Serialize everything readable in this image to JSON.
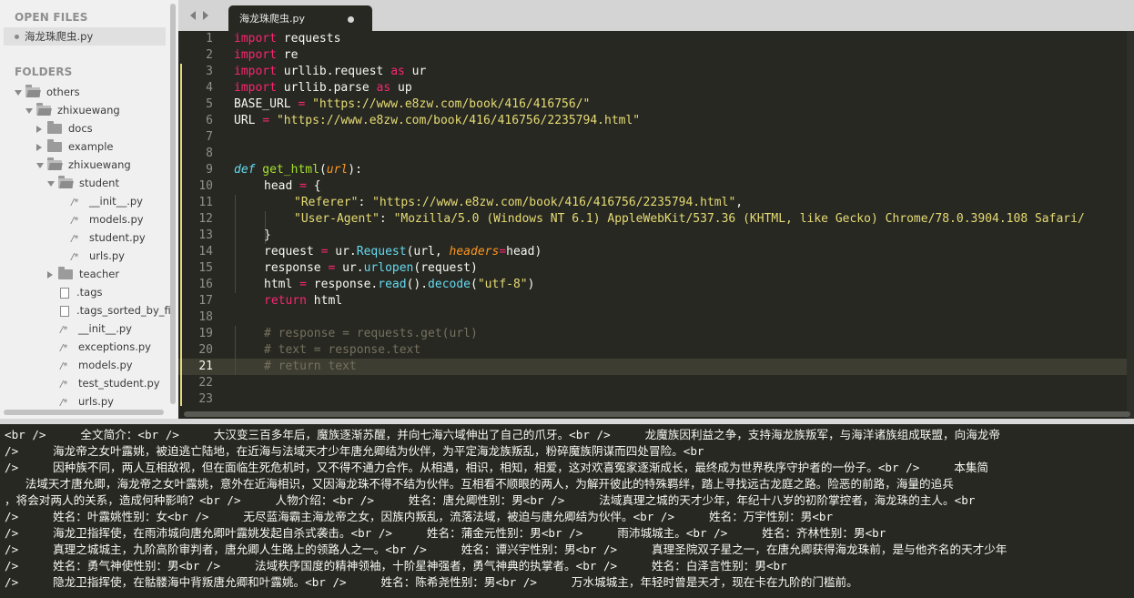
{
  "sidebar": {
    "open_files_heading": "OPEN FILES",
    "open_file": "海龙珠爬虫.py",
    "folders_heading": "FOLDERS",
    "tree": {
      "others": "others",
      "zhixuewang": "zhixuewang",
      "docs": "docs",
      "example": "example",
      "zhixuewang_inner": "zhixuewang",
      "student": "student",
      "student_init": "__init__.py",
      "student_models": "models.py",
      "student_student": "student.py",
      "student_urls": "urls.py",
      "teacher": "teacher",
      "tags": ".tags",
      "tags_sorted": ".tags_sorted_by_fil",
      "init": "__init__.py",
      "exceptions": "exceptions.py",
      "models": "models.py",
      "test_student": "test_student.py",
      "urls": "urls.py"
    }
  },
  "tabbar": {
    "tab_label": "海龙珠爬虫.py"
  },
  "editor": {
    "line_numbers": [
      "1",
      "2",
      "3",
      "4",
      "5",
      "6",
      "7",
      "8",
      "9",
      "10",
      "11",
      "12",
      "13",
      "14",
      "15",
      "16",
      "17",
      "18",
      "19",
      "20",
      "21",
      "22",
      "23"
    ],
    "current_line": "21",
    "code": {
      "l1_kw": "import",
      "l1_rest": " requests",
      "l2_kw": "import",
      "l2_rest": " re",
      "l3_kw": "import",
      "l3_mod": " urllib.request ",
      "l3_as": "as",
      "l3_alias": " ur",
      "l4_kw": "import",
      "l4_mod": " urllib.parse ",
      "l4_as": "as",
      "l4_alias": " up",
      "l5_var": "BASE_URL ",
      "l5_eq": "=",
      "l5_str": " \"https://www.e8zw.com/book/416/416756/\"",
      "l6_var": "URL ",
      "l6_eq": "=",
      "l6_str": " \"https://www.e8zw.com/book/416/416756/2235794.html\"",
      "l9_def": "def",
      "l9_name": " get_html",
      "l9_open": "(",
      "l9_param": "url",
      "l9_close": "):",
      "l10_var": "head ",
      "l10_eq": "=",
      "l10_rest": " {",
      "l11_key": "\"Referer\"",
      "l11_colon": ": ",
      "l11_val": "\"https://www.e8zw.com/book/416/416756/2235794.html\"",
      "l11_end": ",",
      "l12_key": "\"User-Agent\"",
      "l12_colon": ": ",
      "l12_val": "\"Mozilla/5.0 (Windows NT 6.1) AppleWebKit/537.36 (KHTML, like Gecko) Chrome/78.0.3904.108 Safari/",
      "l13": "}",
      "l14_var": "request ",
      "l14_eq": "=",
      "l14_a": " ur.",
      "l14_call": "Request",
      "l14_b": "(url, ",
      "l14_kwarg": "headers",
      "l14_eq2": "=",
      "l14_c": "head)",
      "l15_var": "response ",
      "l15_eq": "=",
      "l15_a": " ur.",
      "l15_call": "urlopen",
      "l15_b": "(request)",
      "l16_var": "html ",
      "l16_eq": "=",
      "l16_a": " response.",
      "l16_call1": "read",
      "l16_b": "().",
      "l16_call2": "decode",
      "l16_c": "(",
      "l16_str": "\"utf-8\"",
      "l16_d": ")",
      "l17_kw": "return",
      "l17_rest": " html",
      "l19": "# response = requests.get(url)",
      "l20": "# text = response.text",
      "l21": "# return text"
    }
  },
  "output": {
    "lines": [
      "<br />     全文简介：<br />     大汉变三百多年后，魔族逐渐苏醒，并向七海六域伸出了自己的爪牙。<br />     龙魔族因利益之争，支持海龙族叛军，与海洋诸族组成联盟，向海龙帝",
      "/>     海龙帝之女叶露姚，被迫逃亡陆地，在近海与法域天才少年唐允卿结为伙伴，为平定海龙族叛乱，粉碎魔族阴谋而四处冒险。<br",
      "/>     因种族不同，两人互相敌视，但在面临生死危机时，又不得不通力合作。从相遇，相识，相知，相爱，这对欢喜冤家逐渐成长，最终成为世界秩序守护者的一份子。<br />     本集简",
      "   法域天才唐允卿，海龙帝之女叶露姚，意外在近海相识，又因海龙珠不得不结为伙伴。互相看不顺眼的两人，为解开彼此的特殊羁绊，踏上寻找远古龙庭之路。险恶的前路，海量的追兵",
      "，将会对两人的关系，造成何种影响？<br />     人物介绍：<br />     姓名：唐允卿性别：男<br />     法域真理之城的天才少年，年纪十八岁的初阶掌控者，海龙珠的主人。<br",
      "/>     姓名：叶露姚性别：女<br />     无尽蓝海霸主海龙帝之女，因族内叛乱，流落法域，被迫与唐允卿结为伙伴。<br />     姓名：万宇性别：男<br",
      "/>     海龙卫指挥使，在雨沛城向唐允卿叶露姚发起自杀式袭击。<br />     姓名：蒲金元性别：男<br />     雨沛城城主。<br />     姓名：齐林性别：男<br",
      "/>     真理之城城主，九阶高阶审判者，唐允卿人生路上的领路人之一。<br />     姓名：谭兴宇性别：男<br />     真理圣院双子星之一，在唐允卿获得海龙珠前，是与他齐名的天才少年",
      "/>     姓名：勇气神使性别：男<br />     法域秩序国度的精神领袖，十阶星神强者，勇气神典的执掌者。<br />     姓名：白泽言性别：男<br",
      "/>     隐龙卫指挥使，在骷髅海中背叛唐允卿和叶露姚。<br />     姓名：陈希尧性别：男<br />     万水城城主，年轻时曾是天才，现在卡在九阶的门槛前。"
    ]
  },
  "colors": {
    "background": "#272822",
    "keyword": "#f92672",
    "string": "#e6db74",
    "function": "#a6e22e",
    "builtin": "#66d9ef",
    "param": "#fd971f",
    "comment": "#75715e"
  }
}
